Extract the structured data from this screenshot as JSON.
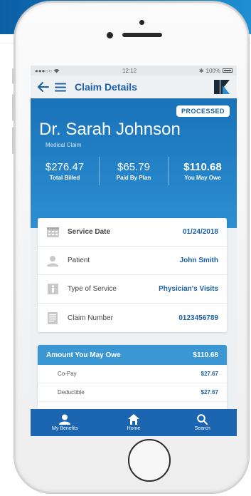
{
  "status_bar": {
    "carrier": "●●●○○",
    "time": "12:12",
    "battery": "100%"
  },
  "nav": {
    "title": "Claim Details"
  },
  "claim": {
    "badge": "PROCESSED",
    "doctor": "Dr. Sarah Johnson",
    "type": "Medical Claim",
    "totals": [
      {
        "value": "$276.47",
        "label": "Total Billed"
      },
      {
        "value": "$65.79",
        "label": "Paid By Plan"
      },
      {
        "value": "$110.68",
        "label": "You May Owe"
      }
    ]
  },
  "details": [
    {
      "label": "Service Date",
      "value": "01/24/2018",
      "icon": "calendar-icon"
    },
    {
      "label": "Patient",
      "value": "John Smith",
      "icon": "person-icon"
    },
    {
      "label": "Type of Service",
      "value": "Physician's Visits",
      "icon": "info-icon"
    },
    {
      "label": "Claim Number",
      "value": "0123456789",
      "icon": "document-icon"
    }
  ],
  "owe": {
    "title": "Amount You May Owe",
    "total": "$110.68",
    "items": [
      {
        "label": "Co-Pay",
        "value": "$27.67"
      },
      {
        "label": "Deductible",
        "value": "$27.67"
      }
    ]
  },
  "tabs": [
    {
      "label": "My Benefits",
      "icon": "person-icon"
    },
    {
      "label": "Home",
      "icon": "home-icon"
    },
    {
      "label": "Search",
      "icon": "search-icon"
    }
  ],
  "colors": {
    "brand": "#1a5fa8",
    "accent": "#3a97d4",
    "hero": "#2d8fd3"
  }
}
